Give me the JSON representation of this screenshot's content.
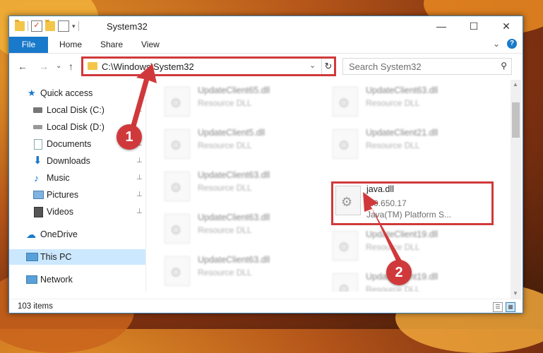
{
  "window": {
    "title": "System32",
    "min_glyph": "—",
    "max_glyph": "☐",
    "close_glyph": "✕"
  },
  "ribbon": {
    "tabs": [
      "File",
      "Home",
      "Share",
      "View"
    ],
    "expand_glyph": "⌄",
    "help_glyph": "?"
  },
  "nav": {
    "back": "←",
    "forward": "→",
    "recent": "⌄",
    "up": "↑"
  },
  "address": {
    "path": "C:\\Windows\\System32",
    "dropdown_glyph": "⌄",
    "refresh_glyph": "↻"
  },
  "search": {
    "placeholder": "Search System32",
    "icon_glyph": "⚲"
  },
  "sidebar": {
    "items": [
      {
        "label": "Quick access"
      },
      {
        "label": "Local Disk (C:)"
      },
      {
        "label": "Local Disk (D:)"
      },
      {
        "label": "Documents"
      },
      {
        "label": "Downloads"
      },
      {
        "label": "Music"
      },
      {
        "label": "Pictures"
      },
      {
        "label": "Videos"
      },
      {
        "label": "OneDrive"
      },
      {
        "label": "This PC"
      },
      {
        "label": "Network"
      }
    ],
    "pin_glyph": "📌"
  },
  "files": [
    {
      "name": "UpdateClient65.dll",
      "type": "Resource DLL"
    },
    {
      "name": "UpdateClient63.dll",
      "type": "Resource DLL"
    },
    {
      "name": "UpdateClient5.dll",
      "type": "Resource DLL"
    },
    {
      "name": "UpdateClient21.dll",
      "type": "Resource DLL"
    },
    {
      "name": "UpdateClient63.dll",
      "type": "Resource DLL"
    },
    {
      "name": "java.dll",
      "type": "8.0.650.17",
      "description": "Java(TM) Platform S..."
    },
    {
      "name": "UpdateClient63.dll",
      "type": "Resource DLL"
    },
    {
      "name": "UpdateClient19.dll",
      "type": "Resource DLL"
    },
    {
      "name": "UpdateClient63.dll",
      "type": "Resource DLL"
    },
    {
      "name": "UpdateClient19.dll",
      "type": "Resource DLL"
    }
  ],
  "status": {
    "item_count": "103 items"
  },
  "annotations": {
    "badge1": "1",
    "badge2": "2",
    "accent_color": "#d0393b"
  },
  "colors": {
    "file_tab": "#1979ca",
    "selection": "#cce8ff",
    "highlight_box": "#d0393b"
  }
}
